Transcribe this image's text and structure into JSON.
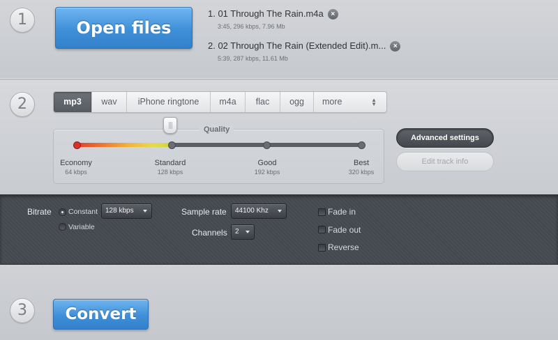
{
  "steps": {
    "one": "1",
    "two": "2",
    "three": "3"
  },
  "step1": {
    "open_label": "Open files",
    "files": [
      {
        "title": "1. 01 Through The Rain.m4a",
        "meta": "3:45, 296 kbps, 7.96 Mb"
      },
      {
        "title": "2. 02 Through The Rain (Extended Edit).m...",
        "meta": "5:39, 287 kbps, 11.61 Mb"
      }
    ]
  },
  "step2": {
    "formats": [
      "mp3",
      "wav",
      "iPhone ringtone",
      "m4a",
      "flac",
      "ogg",
      "more"
    ],
    "selected_format": "mp3",
    "quality_title": "Quality",
    "quality_level": 0.333,
    "quality_stops": [
      {
        "name": "Economy",
        "kbps": "64 kbps"
      },
      {
        "name": "Standard",
        "kbps": "128 kbps"
      },
      {
        "name": "Good",
        "kbps": "192 kbps"
      },
      {
        "name": "Best",
        "kbps": "320 kbps"
      }
    ],
    "advanced_label": "Advanced settings",
    "edit_label": "Edit track info"
  },
  "advanced": {
    "bitrate_label": "Bitrate",
    "constant_label": "Constant",
    "variable_label": "Variable",
    "bitrate_mode": "Constant",
    "bitrate_value": "128 kbps",
    "sample_rate_label": "Sample rate",
    "sample_rate_value": "44100 Khz",
    "channels_label": "Channels",
    "channels_value": "2",
    "fade_in_label": "Fade in",
    "fade_out_label": "Fade out",
    "reverse_label": "Reverse",
    "fade_in": false,
    "fade_out": false,
    "reverse": false
  },
  "step3": {
    "convert_label": "Convert"
  },
  "colors": {
    "accent_blue": "#3f8fd8",
    "panel_dark": "#464a51"
  }
}
